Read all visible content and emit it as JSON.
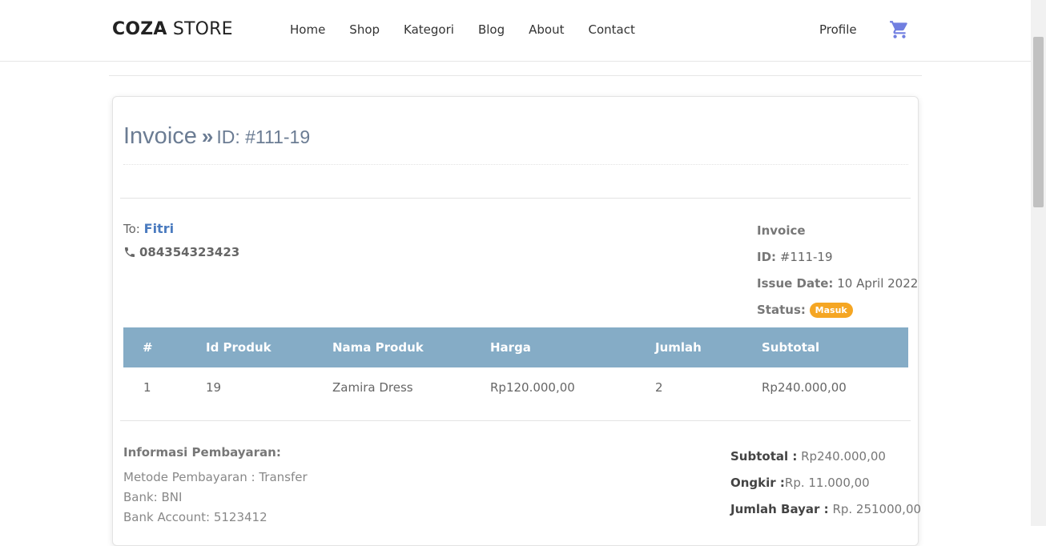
{
  "header": {
    "logo_bold": "COZA",
    "logo_rest": " STORE",
    "nav": [
      "Home",
      "Shop",
      "Kategori",
      "Blog",
      "About",
      "Contact"
    ],
    "profile": "Profile",
    "cart_icon": "shopping-cart-icon",
    "cart_color": "#717fe0"
  },
  "invoice": {
    "title": "Invoice",
    "id_label": "ID: #111-19",
    "to_label": "To:",
    "to_name": "Fitri",
    "phone": "084354323423",
    "meta_title": "Invoice",
    "meta_id_label": "ID:",
    "meta_id_value": "#111-19",
    "issue_label": "Issue Date:",
    "issue_value": "10 April 2022",
    "status_label": "Status:",
    "status_value": "Masuk",
    "status_color": "#f5a623"
  },
  "table": {
    "headers": [
      "#",
      "Id Produk",
      "Nama Produk",
      "Harga",
      "Jumlah",
      "Subtotal"
    ],
    "rows": [
      [
        "1",
        "19",
        "Zamira Dress",
        "Rp120.000,00",
        "2",
        "Rp240.000,00"
      ]
    ],
    "header_bg": "#85acc6"
  },
  "payment": {
    "title": "Informasi Pembayaran:",
    "method": "Metode Pembayaran : Transfer",
    "bank": "Bank: BNI",
    "account": "Bank Account: 5123412"
  },
  "totals": {
    "subtotal_label": "Subtotal :",
    "subtotal_value": " Rp240.000,00",
    "ongkir_label": "Ongkir :",
    "ongkir_value": "Rp. 11.000,00",
    "jumlah_label": "Jumlah Bayar :",
    "jumlah_value": " Rp. 251000,00"
  }
}
